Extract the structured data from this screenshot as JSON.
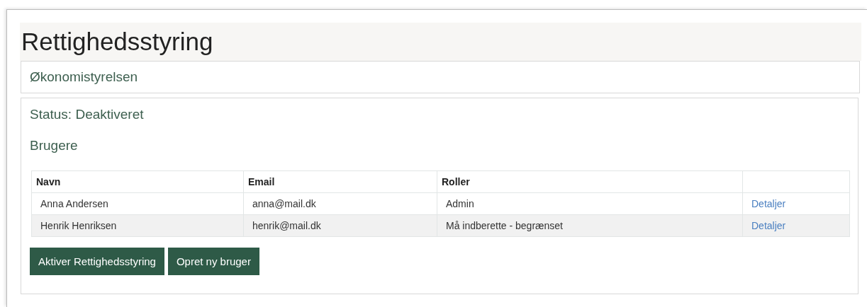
{
  "page": {
    "title": "Rettighedsstyring"
  },
  "organisation": {
    "name": "Økonomistyrelsen"
  },
  "status": {
    "text": "Status: Deaktiveret"
  },
  "users": {
    "heading": "Brugere",
    "table": {
      "columns": [
        "Navn",
        "Email",
        "Roller"
      ],
      "rows": [
        {
          "name": "Anna Andersen",
          "email": "anna@mail.dk",
          "roles": "Admin",
          "link": "Detaljer"
        },
        {
          "name": "Henrik Henriksen",
          "email": "henrik@mail.dk",
          "roles": "Må indberette - begrænset",
          "link": "Detaljer"
        }
      ]
    }
  },
  "buttons": [
    {
      "label": "Aktiver Rettighedsstyring"
    },
    {
      "label": "Opret ny bruger"
    }
  ]
}
